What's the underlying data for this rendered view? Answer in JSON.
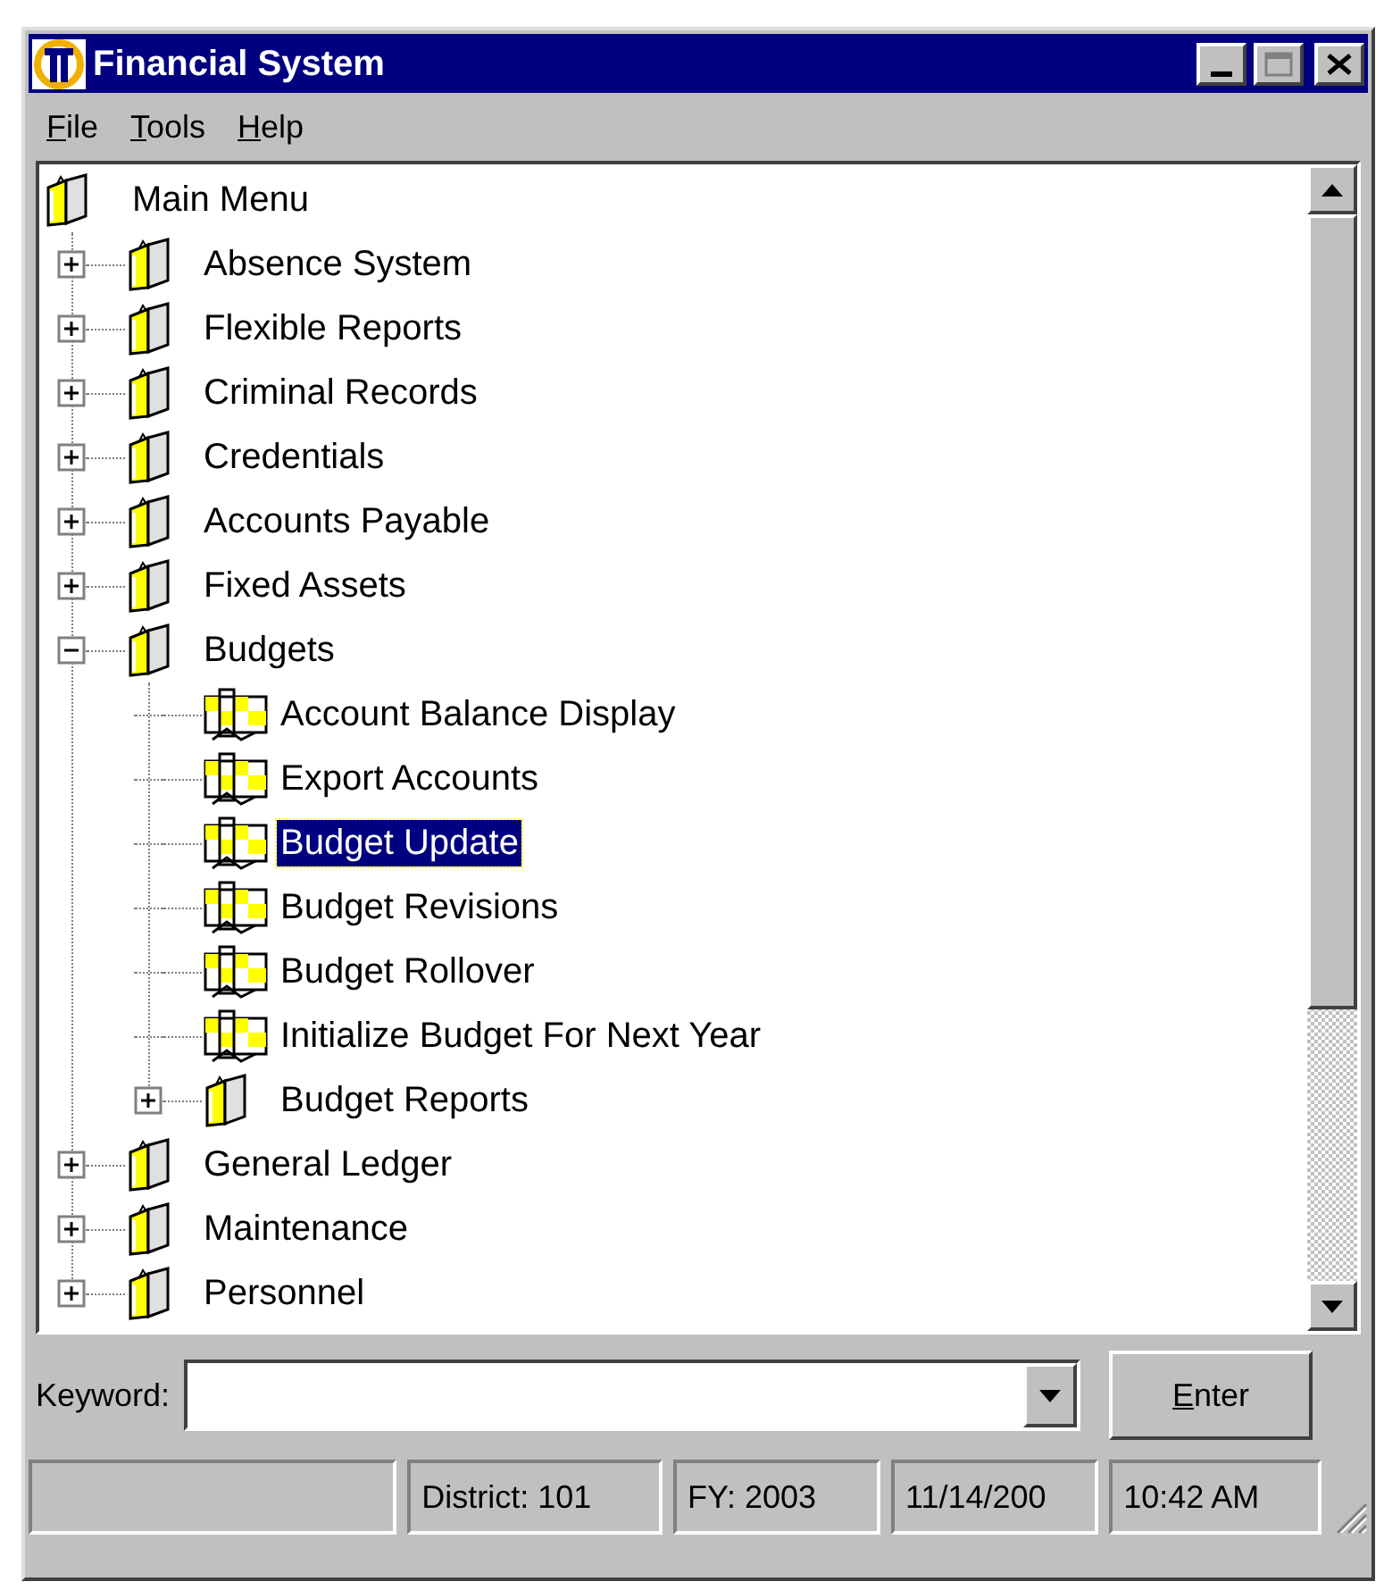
{
  "window": {
    "title": "Financial System"
  },
  "menu": [
    "File",
    "Tools",
    "Help"
  ],
  "tree": [
    {
      "label": "Main Menu",
      "kind": "folder",
      "selected": false,
      "children": [
        {
          "label": "Absence System",
          "kind": "folder",
          "expanded": false,
          "selected": false
        },
        {
          "label": "Flexible Reports",
          "kind": "folder",
          "expanded": false,
          "selected": false
        },
        {
          "label": "Criminal Records",
          "kind": "folder",
          "expanded": false,
          "selected": false
        },
        {
          "label": "Credentials",
          "kind": "folder",
          "expanded": false,
          "selected": false
        },
        {
          "label": "Accounts Payable",
          "kind": "folder",
          "expanded": false,
          "selected": false
        },
        {
          "label": "Fixed Assets",
          "kind": "folder",
          "expanded": false,
          "selected": false
        },
        {
          "label": "Budgets",
          "kind": "folder",
          "expanded": true,
          "selected": false,
          "children": [
            {
              "label": "Account Balance Display",
              "kind": "program",
              "selected": false
            },
            {
              "label": "Export Accounts",
              "kind": "program",
              "selected": false
            },
            {
              "label": "Budget Update",
              "kind": "program",
              "selected": true
            },
            {
              "label": "Budget Revisions",
              "kind": "program",
              "selected": false
            },
            {
              "label": "Budget Rollover",
              "kind": "program",
              "selected": false
            },
            {
              "label": "Initialize Budget For Next Year",
              "kind": "program",
              "selected": false
            },
            {
              "label": "Budget Reports",
              "kind": "folder",
              "expanded": false,
              "selected": false
            }
          ]
        },
        {
          "label": "General Ledger",
          "kind": "folder",
          "expanded": false,
          "selected": false
        },
        {
          "label": "Maintenance",
          "kind": "folder",
          "expanded": false,
          "selected": false
        },
        {
          "label": "Personnel",
          "kind": "folder",
          "expanded": false,
          "selected": false
        }
      ]
    }
  ],
  "keyword": {
    "label": "Keyword:"
  },
  "enter_button": "Enter",
  "status_bar": [
    "District: 101",
    "FY: 2003",
    "11/14/200",
    "10:42 AM"
  ]
}
